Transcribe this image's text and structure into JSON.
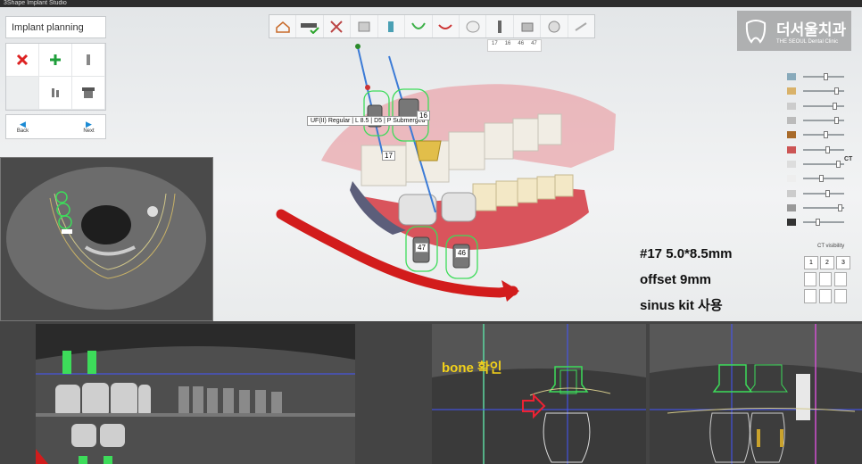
{
  "window": {
    "title": "3Shape Implant Studio"
  },
  "left_panel": {
    "title": "Implant planning",
    "tools": [
      "delete-tool",
      "add-tool",
      "implant-tool",
      "empty",
      "abutment-tool",
      "sleeve-tool"
    ],
    "back_label": "Back",
    "next_label": "Next"
  },
  "toolbar": {
    "icons": [
      "home-icon",
      "scan-check-icon",
      "tools-icon",
      "bone-icon",
      "implant-icon",
      "gum-icon",
      "nerve-icon",
      "crown-icon",
      "implant-select-icon",
      "sleeve-icon",
      "drill-icon",
      "link-icon"
    ]
  },
  "tooth_tabs": [
    "17",
    "16",
    "46",
    "47"
  ],
  "logo": {
    "korean": "더서울치과",
    "english": "THE SEOUL Dental Clinic"
  },
  "tooltip": "UF(II) Regular | L 8.5 | D5 | P Submerged",
  "labels": {
    "t16": "16",
    "t17": "17",
    "t47": "47",
    "t46": "46"
  },
  "annotation": {
    "line1": "#17 5.0*8.5mm",
    "line2": "offset 9mm",
    "line3": "sinus kit 사용"
  },
  "right_panel": {
    "slider_values": [
      0.55,
      0.85,
      0.8,
      0.85,
      0.55,
      0.6,
      0.9,
      0.45,
      0.6,
      0.95,
      0.35
    ],
    "ct_label": "CT",
    "ct_visibility": "CT visibility",
    "ct_numbers": [
      "1",
      "2",
      "3"
    ]
  },
  "bottom": {
    "bone_label": "bone 확인"
  },
  "colors": {
    "nerve": "#d21c1c",
    "implant_outline": "#3ddc5a",
    "annotation_yellow": "#f2d11a"
  }
}
